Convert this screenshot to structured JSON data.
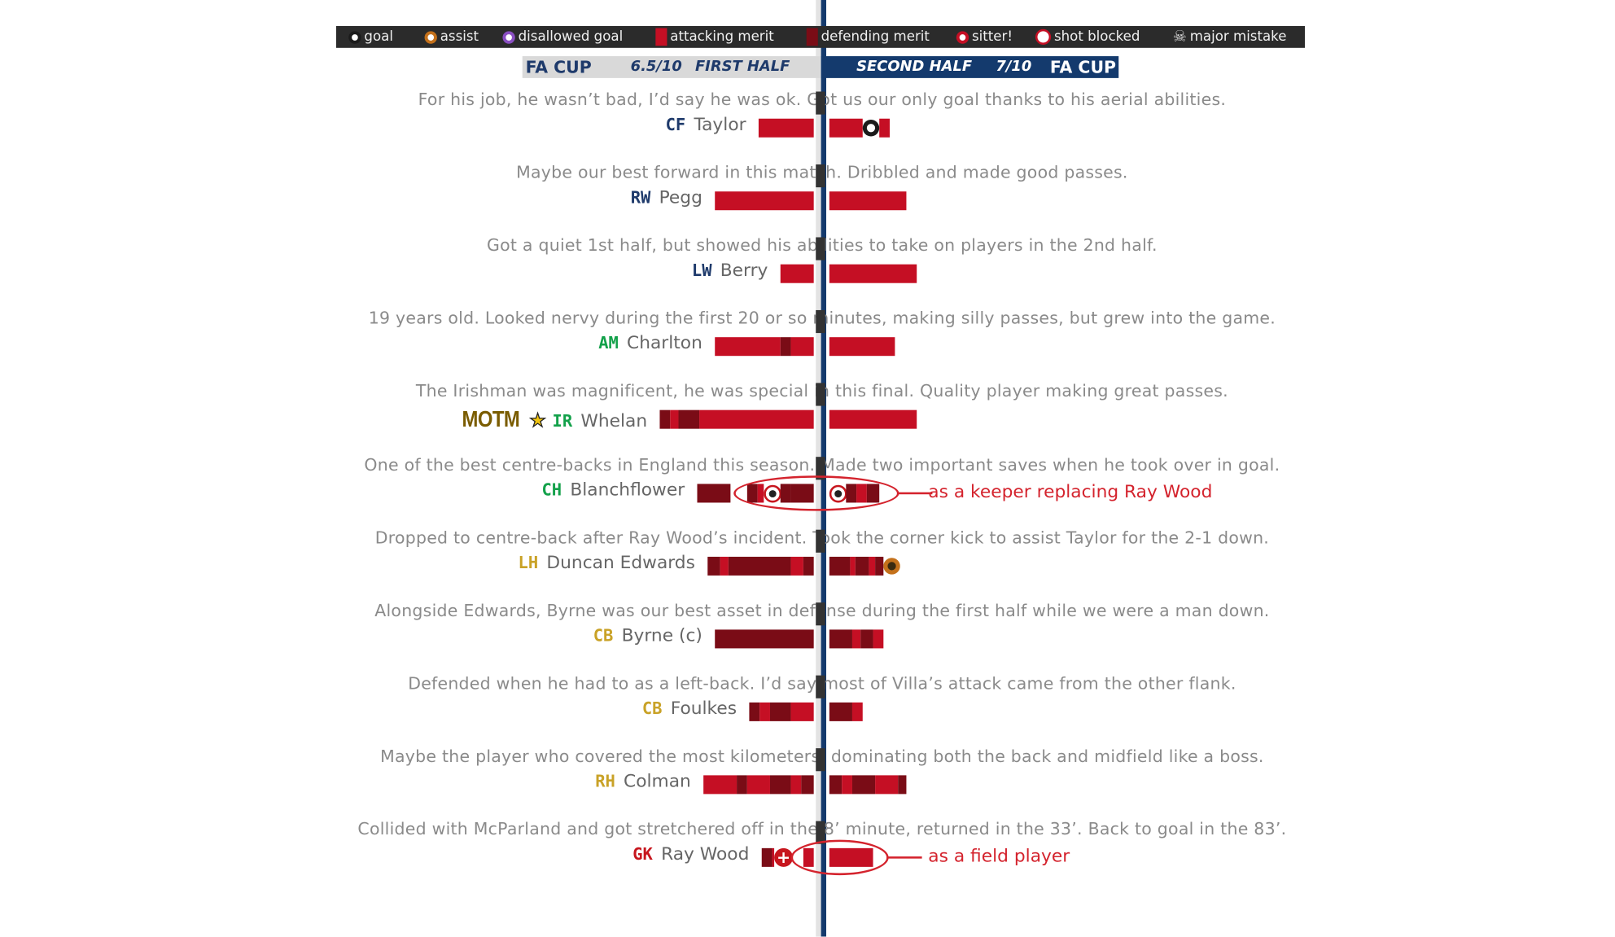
{
  "legend": [
    {
      "icon": "goal-icon",
      "label": "goal",
      "color": "#1b1b1b"
    },
    {
      "icon": "assist-icon",
      "label": "assist",
      "color": "#c4711b"
    },
    {
      "icon": "disallowed-goal-icon",
      "label": "disallowed goal",
      "color": "#8a4fc2"
    },
    {
      "icon": "attacking-merit-swatch",
      "label": "attacking merit",
      "color": "#c50f24"
    },
    {
      "icon": "defending-merit-swatch",
      "label": "defending merit",
      "color": "#7a0c16"
    },
    {
      "icon": "sitter-icon",
      "label": "sitter!",
      "color": "#c50f24"
    },
    {
      "icon": "shot-blocked-icon",
      "label": "shot blocked",
      "color": "#c50f24"
    },
    {
      "icon": "skull-icon",
      "label": "major mistake",
      "color": "#dddddd"
    }
  ],
  "header": {
    "left": {
      "competition": "FA CUP",
      "rating": "6.5/10",
      "half": "FIRST HALF"
    },
    "right": {
      "half": "SECOND HALF",
      "rating": "7/10",
      "competition": "FA CUP"
    }
  },
  "colors": {
    "attacking": "#c50f24",
    "defending": "#7a0c16",
    "pos_forward": "#1e3a6b",
    "pos_midfield": "#13a14a",
    "pos_defense": "#c9a227",
    "pos_goalkeeper": "#c7161e",
    "motm": "#7a5c00",
    "annotation": "#d4232d"
  },
  "motm": "MOTM",
  "players": [
    {
      "pos": "CF",
      "name": "Taylor",
      "posColor": "#1e3a6b",
      "comment": "For his job, he wasn’t bad, I’d say he was ok. Got us our only goal thanks to his aerial abilities.",
      "first": [
        [
          "a",
          53
        ]
      ],
      "second": [
        [
          "a",
          32
        ],
        [
          "goal"
        ],
        [
          "a",
          10
        ]
      ]
    },
    {
      "pos": "RW",
      "name": "Pegg",
      "posColor": "#1e3a6b",
      "comment": "Maybe our best forward in this match. Dribbled and made good passes.",
      "first": [
        [
          "a",
          95
        ]
      ],
      "second": [
        [
          "a",
          74
        ]
      ]
    },
    {
      "pos": "LW",
      "name": "Berry",
      "posColor": "#1e3a6b",
      "comment": "Got a quiet 1st half, but showed his abilities to take on players in the 2nd half.",
      "first": [
        [
          "a",
          32
        ]
      ],
      "second": [
        [
          "a",
          84
        ]
      ]
    },
    {
      "pos": "AM",
      "name": "Charlton",
      "posColor": "#13a14a",
      "comment": "19 years old. Looked nervy during the first 20 or so minutes, making silly passes, but grew into the game.",
      "first": [
        [
          "a",
          63
        ],
        [
          "d",
          10
        ],
        [
          "a",
          22
        ]
      ],
      "second": [
        [
          "a",
          63
        ]
      ]
    },
    {
      "pos": "IR",
      "name": "Whelan",
      "posColor": "#13a14a",
      "motm": true,
      "comment": "The Irishman was magnificent, he was special in this final. Quality player making great passes.",
      "first": [
        [
          "d",
          10
        ],
        [
          "a",
          8
        ],
        [
          "d",
          20
        ],
        [
          "a",
          110
        ]
      ],
      "second": [
        [
          "a",
          84
        ]
      ]
    },
    {
      "pos": "CH",
      "name": "Blanchflower",
      "posColor": "#13a14a",
      "comment": "One of the best centre-backs in England this season. Made two important saves when he took over in goal.",
      "first": [
        [
          "d",
          32
        ],
        [
          "gap",
          16
        ],
        [
          "d",
          10
        ],
        [
          "a",
          6
        ],
        [
          "blocked"
        ],
        [
          "d",
          10
        ],
        [
          "d",
          22
        ]
      ],
      "second": [
        [
          "blocked"
        ],
        [
          "d",
          10
        ],
        [
          "a",
          10
        ],
        [
          "d",
          12
        ]
      ],
      "annotation": "as a keeper replacing Ray Wood"
    },
    {
      "pos": "LH",
      "name": "Duncan Edwards",
      "posColor": "#c9a227",
      "comment": "Dropped to centre-back after Ray Wood’s incident. Took the corner kick to assist Taylor for the 2-1 down.",
      "first": [
        [
          "d",
          12
        ],
        [
          "a",
          8
        ],
        [
          "d",
          60
        ],
        [
          "a",
          12
        ],
        [
          "d",
          10
        ]
      ],
      "second": [
        [
          "d",
          20
        ],
        [
          "a",
          5
        ],
        [
          "d",
          13
        ],
        [
          "a",
          6
        ],
        [
          "d",
          8
        ],
        [
          "assist"
        ]
      ]
    },
    {
      "pos": "CB",
      "name": "Byrne (c)",
      "posColor": "#c9a227",
      "comment": "Alongside Edwards, Byrne was our best asset in defense during the first half while we were a man down.",
      "first": [
        [
          "d",
          95
        ]
      ],
      "second": [
        [
          "d",
          22
        ],
        [
          "a",
          8
        ],
        [
          "d",
          12
        ],
        [
          "a",
          10
        ]
      ]
    },
    {
      "pos": "CB",
      "name": "Foulkes",
      "posColor": "#c9a227",
      "comment": "Defended when he had to as a left-back. I’d say most of Villa’s attack came from the other flank.",
      "first": [
        [
          "d",
          10
        ],
        [
          "a",
          10
        ],
        [
          "d",
          20
        ],
        [
          "a",
          22
        ]
      ],
      "second": [
        [
          "d",
          22
        ],
        [
          "a",
          10
        ]
      ]
    },
    {
      "pos": "RH",
      "name": "Colman",
      "posColor": "#c9a227",
      "comment": "Maybe the player who covered the most kilometers, dominating both the back and midfield like a boss.",
      "first": [
        [
          "a",
          32
        ],
        [
          "d",
          10
        ],
        [
          "a",
          22
        ],
        [
          "d",
          20
        ],
        [
          "a",
          10
        ],
        [
          "d",
          12
        ]
      ],
      "second": [
        [
          "d",
          12
        ],
        [
          "a",
          10
        ],
        [
          "d",
          22
        ],
        [
          "a",
          22
        ],
        [
          "d",
          8
        ]
      ]
    },
    {
      "pos": "GK",
      "name": "Ray Wood",
      "posColor": "#c7161e",
      "comment": "Collided with McParland and got stretchered off in the 8’ minute, returned in the 33’. Back to goal in the 83’.",
      "first": [
        [
          "gap",
          0
        ],
        [
          "d",
          10
        ],
        [
          "a",
          2
        ],
        [
          "cross"
        ],
        [
          "gap",
          12
        ],
        [
          "a",
          10
        ]
      ],
      "second": [
        [
          "a",
          42
        ]
      ],
      "annotation": "as a field player"
    }
  ]
}
